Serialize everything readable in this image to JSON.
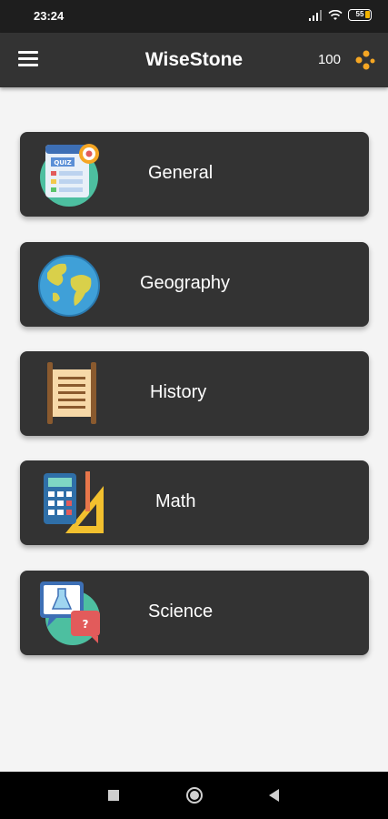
{
  "status_bar": {
    "time": "23:24",
    "battery": "55"
  },
  "app_bar": {
    "title": "WiseStone",
    "score": "100"
  },
  "categories": [
    {
      "label": "General",
      "icon": "quiz-icon"
    },
    {
      "label": "Geography",
      "icon": "globe-icon"
    },
    {
      "label": "History",
      "icon": "scroll-icon"
    },
    {
      "label": "Math",
      "icon": "calculator-icon"
    },
    {
      "label": "Science",
      "icon": "flask-chat-icon"
    }
  ],
  "colors": {
    "app_bar": "#333333",
    "card": "#333333",
    "background": "#f4f4f4",
    "coin": "#f5a623"
  }
}
